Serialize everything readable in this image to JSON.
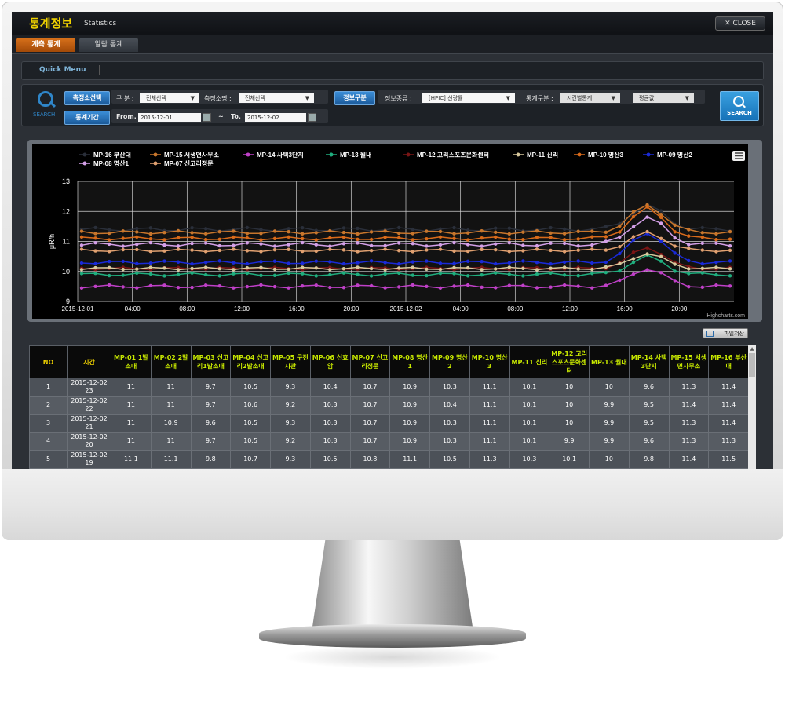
{
  "window": {
    "title": "통계정보",
    "subtitle": "Statistics",
    "close_label": "CLOSE"
  },
  "tabs": [
    {
      "label": "계측 통계",
      "active": true
    },
    {
      "label": "알람 통계",
      "active": false
    }
  ],
  "quick_menu": {
    "label": "Quick Menu"
  },
  "search": {
    "caption": "SEARCH",
    "btn_station": "측정소선택",
    "lbl_category": "구 분 :",
    "category_value": "전체선택",
    "lbl_station_name": "측정소명 :",
    "station_value": "전체선택",
    "btn_info_type": "정보구분",
    "lbl_info_kind": "정보종류 :",
    "info_kind_value": "[HPIC] 선량률",
    "lbl_stat_type": "통계구분 :",
    "stat_type_value": "시간별통계",
    "stat_agg_value": "평균값",
    "btn_period": "통계기간",
    "lbl_from": "From.",
    "from_date": "2015-12-01",
    "tilde": "~",
    "lbl_to": "To.",
    "to_date": "2015-12-02",
    "search_button": "SEARCH"
  },
  "chart_data": {
    "type": "line",
    "ylabel": "μR/h",
    "ylim": [
      9,
      13
    ],
    "yticks": [
      9,
      10,
      11,
      12,
      13
    ],
    "xticks": [
      "2015-12-01",
      "04:00",
      "08:00",
      "12:00",
      "16:00",
      "20:00",
      "2015-12-02",
      "04:00",
      "08:00",
      "12:00",
      "16:00",
      "20:00"
    ],
    "credit": "Highcharts.com",
    "legend_position": "top",
    "series": [
      {
        "name": "MP-16 부산대",
        "color": "#2a2f3a",
        "base": 11.4
      },
      {
        "name": "MP-15 서생면사무소",
        "color": "#c8762c",
        "base": 11.3
      },
      {
        "name": "MP-14 사택3단지",
        "color": "#c040c8",
        "base": 9.5
      },
      {
        "name": "MP-13 월내",
        "color": "#1fae7e",
        "base": 9.9
      },
      {
        "name": "MP-12 고리스포츠문화센터",
        "color": "#7a1515",
        "base": 10.1
      },
      {
        "name": "MP-11 신리",
        "color": "#d8c89c",
        "base": 10.1
      },
      {
        "name": "MP-10 명산3",
        "color": "#d86a1a",
        "base": 11.1
      },
      {
        "name": "MP-09 명산2",
        "color": "#1a2ad8",
        "base": 10.3
      },
      {
        "name": "MP-08 명산1",
        "color": "#d4a0e8",
        "base": 10.9
      },
      {
        "name": "MP-07 신고리정문",
        "color": "#e0a070",
        "base": 10.7
      }
    ]
  },
  "table": {
    "save_label": "파일저장",
    "headers": [
      "NO",
      "시간",
      "MP-01 1발소내",
      "MP-02 2발소내",
      "MP-03 신고리1발소내",
      "MP-04 신고리2발소내",
      "MP-05 구전시관",
      "MP-06 신효암",
      "MP-07 신고리정문",
      "MP-08 명산1",
      "MP-09 명산2",
      "MP-10 명산3",
      "MP-11 신리",
      "MP-12 고리스포츠문화센터",
      "MP-13 월내",
      "MP-14 사택3단지",
      "MP-15 서생면사무소",
      "MP-16 부산대"
    ],
    "rows": [
      [
        "1",
        "2015-12-02 23",
        "11",
        "11",
        "9.7",
        "10.5",
        "9.3",
        "10.4",
        "10.7",
        "10.9",
        "10.3",
        "11.1",
        "10.1",
        "10",
        "10",
        "9.6",
        "11.3",
        "11.4"
      ],
      [
        "2",
        "2015-12-02 22",
        "11",
        "11",
        "9.7",
        "10.6",
        "9.2",
        "10.3",
        "10.7",
        "10.9",
        "10.4",
        "11.1",
        "10.1",
        "10",
        "9.9",
        "9.5",
        "11.4",
        "11.4"
      ],
      [
        "3",
        "2015-12-02 21",
        "11",
        "10.9",
        "9.6",
        "10.5",
        "9.3",
        "10.3",
        "10.7",
        "10.9",
        "10.3",
        "11.1",
        "10.1",
        "10",
        "9.9",
        "9.5",
        "11.3",
        "11.4"
      ],
      [
        "4",
        "2015-12-02 20",
        "11",
        "11",
        "9.7",
        "10.5",
        "9.2",
        "10.3",
        "10.7",
        "10.9",
        "10.3",
        "11.1",
        "10.1",
        "9.9",
        "9.9",
        "9.6",
        "11.3",
        "11.3"
      ],
      [
        "5",
        "2015-12-02 19",
        "11.1",
        "11.1",
        "9.8",
        "10.7",
        "9.3",
        "10.5",
        "10.8",
        "11.1",
        "10.5",
        "11.3",
        "10.3",
        "10.1",
        "10",
        "9.8",
        "11.4",
        "11.5"
      ]
    ]
  }
}
